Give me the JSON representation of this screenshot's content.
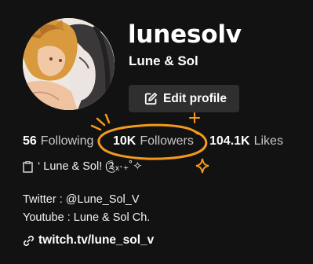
{
  "profile": {
    "username": "lunesolv",
    "display_name": "Lune & Sol",
    "edit_button_label": "Edit profile"
  },
  "stats": {
    "following": {
      "value": "56",
      "label": "Following"
    },
    "followers": {
      "value": "10K",
      "label": "Followers"
    },
    "likes": {
      "value": "104.1K",
      "label": "Likes"
    }
  },
  "bio": {
    "line1": "‘ Lune & Sol! ༊ₓ·₊˚✧",
    "line2": "Twitter : @Lune_Sol_V",
    "line3": "Youtube : Lune & Sol Ch."
  },
  "link": {
    "text": "twitch.tv/lune_sol_v"
  },
  "colors": {
    "background": "#121212",
    "button_bg": "#2f2f2f",
    "accent_orange": "#f39a1c",
    "secondary_text": "#c9c9c9"
  },
  "icons": {
    "edit": "edit-square-icon",
    "clipboard": "clipboard-icon",
    "link": "link-icon"
  }
}
